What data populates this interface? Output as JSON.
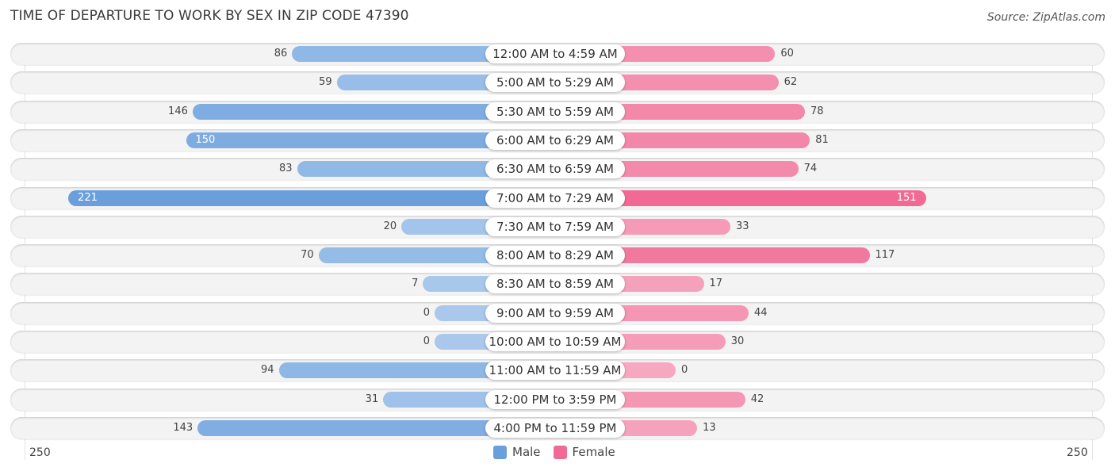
{
  "title": "TIME OF DEPARTURE TO WORK BY SEX IN ZIP CODE 47390",
  "source": "Source: ZipAtlas.com",
  "colors": {
    "male": "#6a9fdc",
    "male_light": "#a9c8ec",
    "female": "#f06a95",
    "female_light": "#f6a8c1"
  },
  "chart_data": {
    "type": "bar",
    "orientation": "horizontal-diverging",
    "title": "TIME OF DEPARTURE TO WORK BY SEX IN ZIP CODE 47390",
    "categories": [
      "12:00 AM to 4:59 AM",
      "5:00 AM to 5:29 AM",
      "5:30 AM to 5:59 AM",
      "6:00 AM to 6:29 AM",
      "6:30 AM to 6:59 AM",
      "7:00 AM to 7:29 AM",
      "7:30 AM to 7:59 AM",
      "8:00 AM to 8:29 AM",
      "8:30 AM to 8:59 AM",
      "9:00 AM to 9:59 AM",
      "10:00 AM to 10:59 AM",
      "11:00 AM to 11:59 AM",
      "12:00 PM to 3:59 PM",
      "4:00 PM to 11:59 PM"
    ],
    "series": [
      {
        "name": "Male",
        "values": [
          86,
          59,
          146,
          150,
          83,
          221,
          20,
          70,
          7,
          0,
          0,
          94,
          31,
          143
        ]
      },
      {
        "name": "Female",
        "values": [
          60,
          62,
          78,
          81,
          74,
          151,
          33,
          117,
          17,
          44,
          30,
          0,
          42,
          13
        ]
      }
    ],
    "xlim": [
      -250,
      250
    ],
    "axis_labels": {
      "left": "250",
      "right": "250"
    },
    "legend": {
      "position": "bottom-center",
      "entries": [
        "Male",
        "Female"
      ]
    }
  }
}
